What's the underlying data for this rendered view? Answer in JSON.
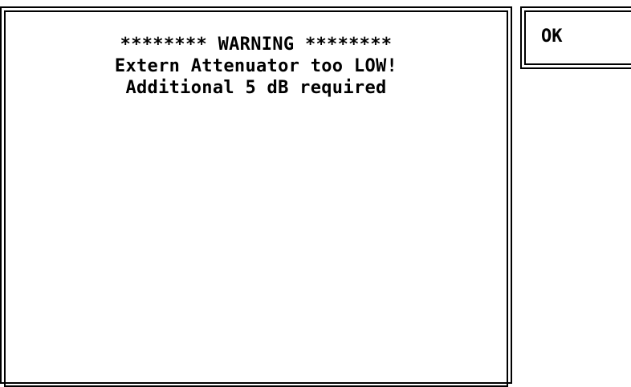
{
  "dialog": {
    "lines": [
      "******** WARNING ********",
      "Extern Attenuator too LOW!",
      "Additional 5 dB required"
    ]
  },
  "softkeys": {
    "ok_label": "OK"
  }
}
